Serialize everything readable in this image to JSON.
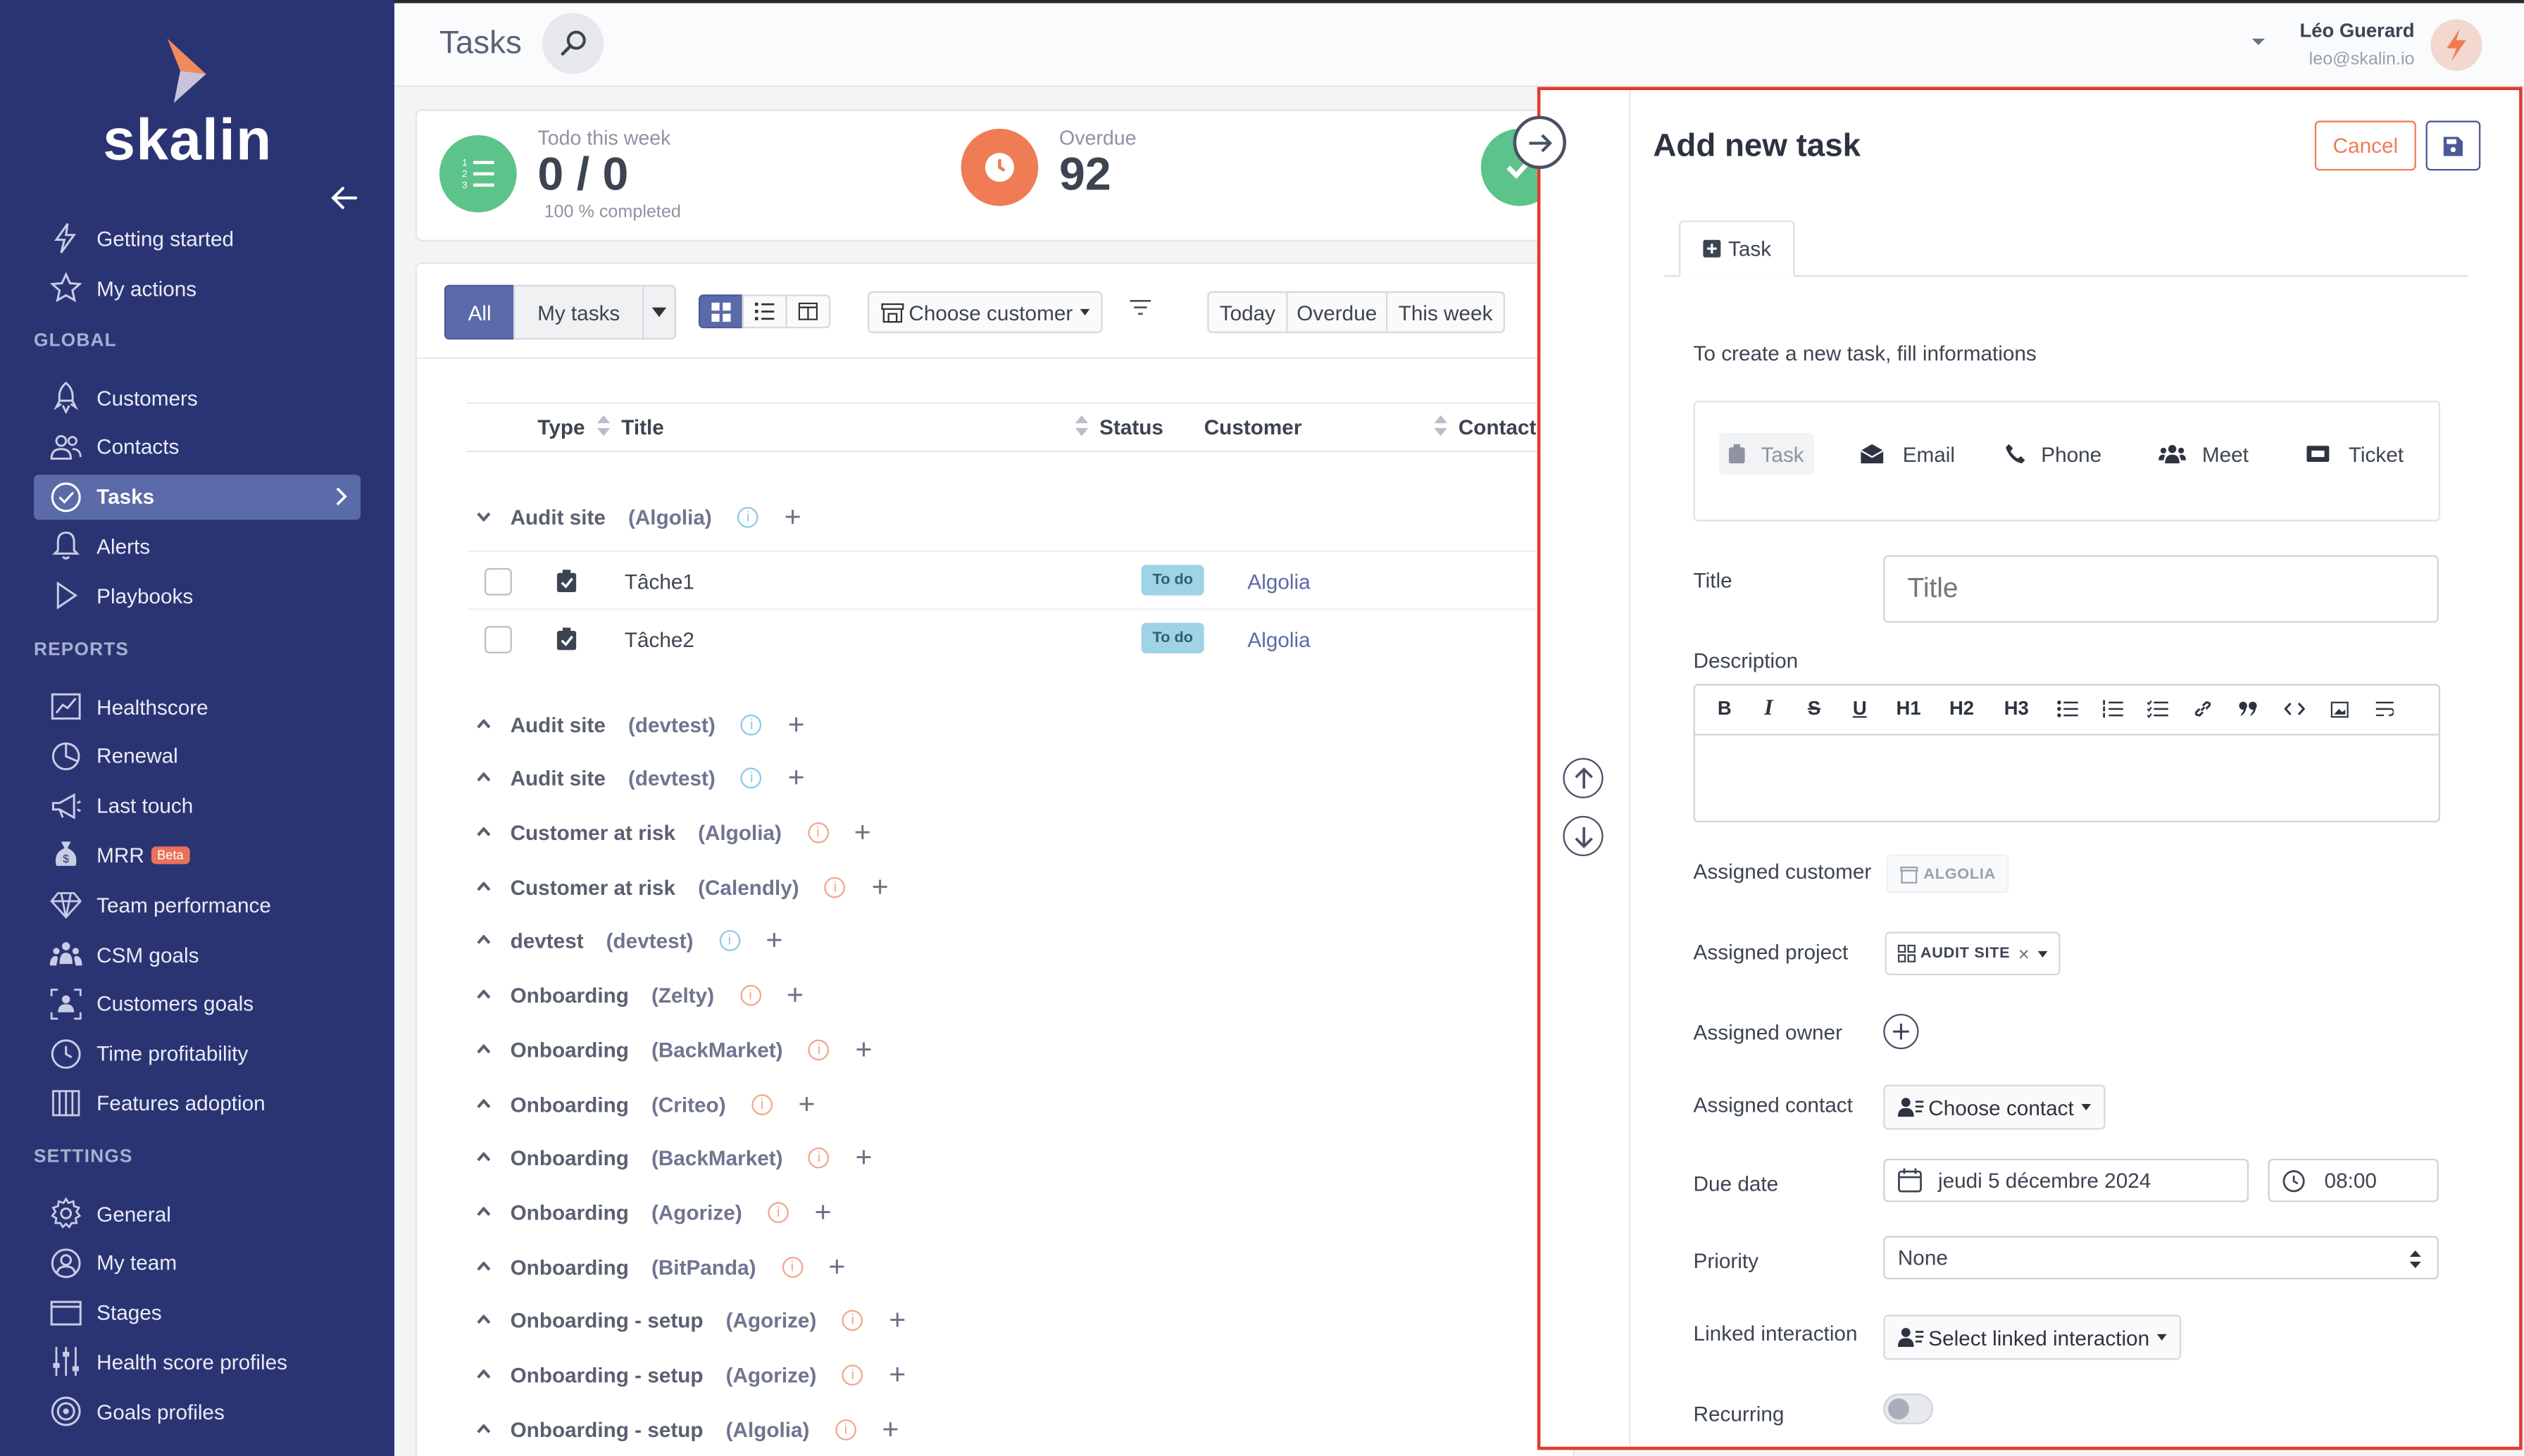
{
  "brand": {
    "logo_text": "skalin",
    "accent": "#f08c5c",
    "sidebar_bg": "#2b3473"
  },
  "sidebar": {
    "top_items": [
      {
        "label": "Getting started",
        "icon": "lightning-icon"
      },
      {
        "label": "My actions",
        "icon": "star-icon"
      }
    ],
    "sections": [
      {
        "title": "GLOBAL",
        "items": [
          {
            "label": "Customers",
            "icon": "rocket-icon"
          },
          {
            "label": "Contacts",
            "icon": "users-icon"
          },
          {
            "label": "Tasks",
            "icon": "check-circle-icon",
            "active": true
          },
          {
            "label": "Alerts",
            "icon": "bell-icon"
          },
          {
            "label": "Playbooks",
            "icon": "play-icon"
          }
        ]
      },
      {
        "title": "REPORTS",
        "items": [
          {
            "label": "Healthscore",
            "icon": "chart-icon"
          },
          {
            "label": "Renewal",
            "icon": "pie-icon"
          },
          {
            "label": "Last touch",
            "icon": "megaphone-icon"
          },
          {
            "label": "MRR",
            "icon": "money-bag-icon",
            "badge": "Beta"
          },
          {
            "label": "Team performance",
            "icon": "diamond-icon"
          },
          {
            "label": "CSM goals",
            "icon": "team-goal-icon"
          },
          {
            "label": "Customers goals",
            "icon": "target-users-icon"
          },
          {
            "label": "Time profitability",
            "icon": "clock-icon"
          },
          {
            "label": "Features adoption",
            "icon": "columns-icon"
          }
        ]
      },
      {
        "title": "SETTINGS",
        "items": [
          {
            "label": "General",
            "icon": "gear-icon"
          },
          {
            "label": "My team",
            "icon": "user-circle-icon"
          },
          {
            "label": "Stages",
            "icon": "window-icon"
          },
          {
            "label": "Health score profiles",
            "icon": "sliders-icon"
          },
          {
            "label": "Goals profiles",
            "icon": "target-icon"
          }
        ]
      }
    ]
  },
  "header": {
    "title": "Tasks",
    "user_name": "Léo Guerard",
    "user_email": "leo@skalin.io"
  },
  "stats": {
    "todo": {
      "label": "Todo this week",
      "value": "0 / 0",
      "sub": "100 % completed"
    },
    "overdue": {
      "label": "Overdue",
      "value": "92"
    }
  },
  "toolbar": {
    "filter_all": "All",
    "filter_mine": "My tasks",
    "choose_customer": "Choose customer",
    "period": [
      "Today",
      "Overdue",
      "This week"
    ]
  },
  "table": {
    "columns": {
      "type": "Type",
      "title": "Title",
      "status": "Status",
      "customer": "Customer",
      "contact": "Contact"
    },
    "first_group": {
      "name": "Audit site",
      "customer": "(Algolia)",
      "tasks": [
        {
          "title": "Tâche1",
          "status": "To do",
          "customer": "Algolia"
        },
        {
          "title": "Tâche2",
          "status": "To do",
          "customer": "Algolia"
        }
      ]
    },
    "groups": [
      {
        "name": "Audit site",
        "customer": "(devtest)",
        "info": "blue"
      },
      {
        "name": "Audit site",
        "customer": "(devtest)",
        "info": "blue"
      },
      {
        "name": "Customer at risk",
        "customer": "(Algolia)",
        "info": "orange"
      },
      {
        "name": "Customer at risk",
        "customer": "(Calendly)",
        "info": "orange"
      },
      {
        "name": "devtest",
        "customer": "(devtest)",
        "info": "blue"
      },
      {
        "name": "Onboarding",
        "customer": "(Zelty)",
        "info": "orange"
      },
      {
        "name": "Onboarding",
        "customer": "(BackMarket)",
        "info": "orange"
      },
      {
        "name": "Onboarding",
        "customer": "(Criteo)",
        "info": "orange"
      },
      {
        "name": "Onboarding",
        "customer": "(BackMarket)",
        "info": "orange"
      },
      {
        "name": "Onboarding",
        "customer": "(Agorize)",
        "info": "orange"
      },
      {
        "name": "Onboarding",
        "customer": "(BitPanda)",
        "info": "orange"
      },
      {
        "name": "Onboarding - setup",
        "customer": "(Agorize)",
        "info": "orange"
      },
      {
        "name": "Onboarding - setup",
        "customer": "(Agorize)",
        "info": "orange"
      },
      {
        "name": "Onboarding - setup",
        "customer": "(Algolia)",
        "info": "orange"
      }
    ]
  },
  "panel": {
    "title": "Add new task",
    "cancel": "Cancel",
    "tab": "Task",
    "intro": "To create a new task, fill informations",
    "types": [
      "Task",
      "Email",
      "Phone",
      "Meet",
      "Ticket"
    ],
    "labels": {
      "title": "Title",
      "description": "Description",
      "assigned_customer": "Assigned customer",
      "assigned_project": "Assigned project",
      "assigned_owner": "Assigned owner",
      "assigned_contact": "Assigned contact",
      "due_date": "Due date",
      "priority": "Priority",
      "linked_interaction": "Linked interaction",
      "recurring": "Recurring"
    },
    "title_placeholder": "Title",
    "toolbar": [
      "B",
      "I",
      "S",
      "U",
      "H1",
      "H2",
      "H3"
    ],
    "customer_chip": "ALGOLIA",
    "project_chip": "AUDIT SITE",
    "choose_contact": "Choose contact",
    "due_date_value": "jeudi 5 décembre 2024",
    "due_time_value": "08:00",
    "priority_value": "None",
    "linked_placeholder": "Select linked interaction"
  }
}
